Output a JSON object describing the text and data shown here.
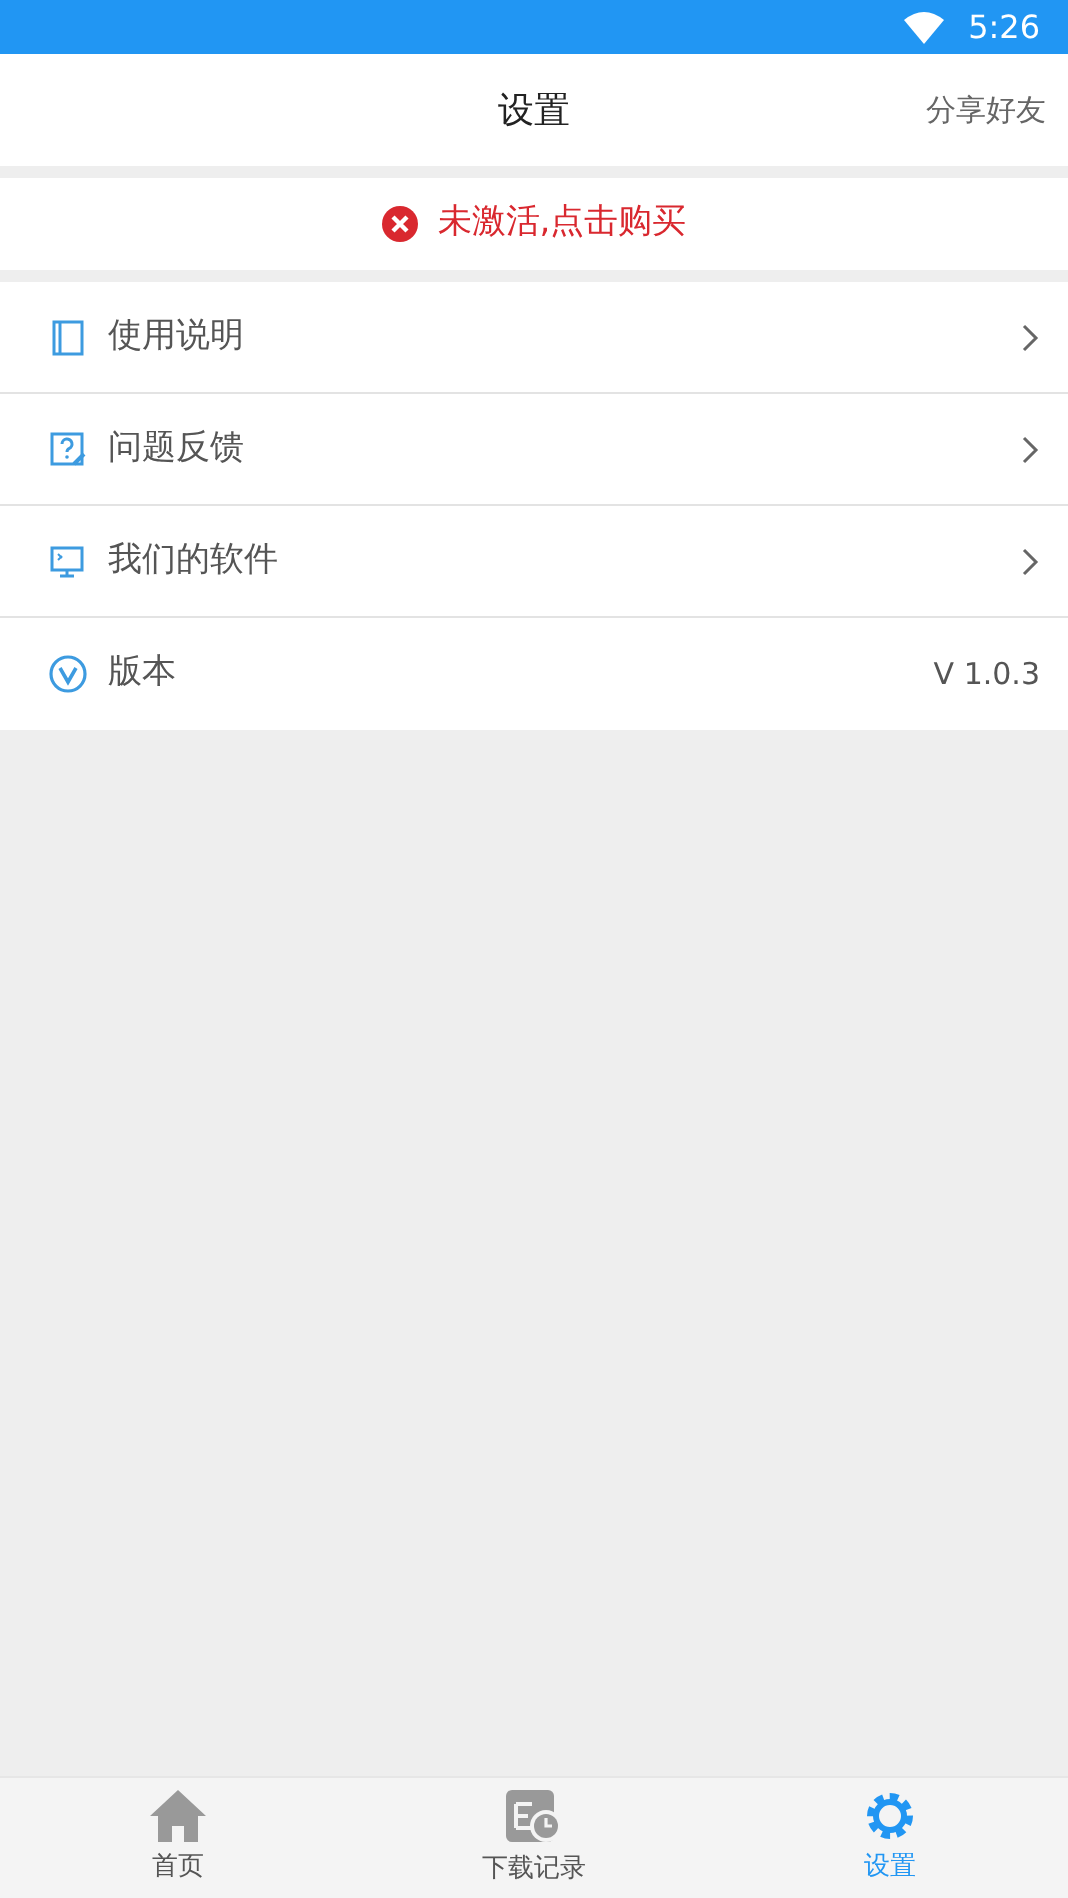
{
  "status_bar": {
    "time": "5:26"
  },
  "header": {
    "title": "设置",
    "action": "分享好友"
  },
  "activation": {
    "text": "未激活,点击购买"
  },
  "menu": [
    {
      "kind": "manual",
      "label": "使用说明"
    },
    {
      "kind": "feedback",
      "label": "问题反馈"
    },
    {
      "kind": "software",
      "label": "我们的软件"
    },
    {
      "kind": "version",
      "label": "版本",
      "value": "V 1.0.3"
    }
  ],
  "tabs": [
    {
      "kind": "home",
      "label": "首页",
      "selected": false
    },
    {
      "kind": "downloads",
      "label": "下载记录",
      "selected": false
    },
    {
      "kind": "settings",
      "label": "设置",
      "selected": true
    }
  ]
}
